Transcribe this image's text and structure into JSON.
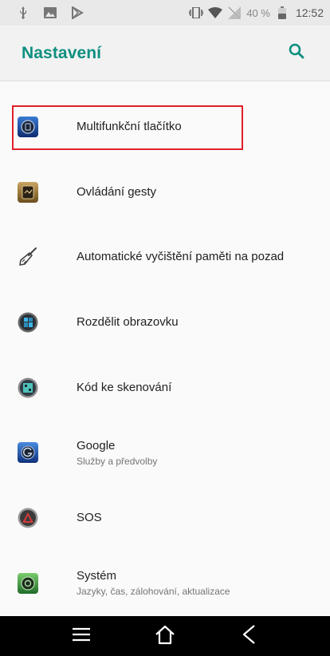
{
  "status_bar": {
    "battery_percent_text": "40 %",
    "time": "12:52",
    "icons_left": [
      "usb-icon",
      "image-icon",
      "play-store-icon"
    ],
    "icons_right": [
      "vibrate-icon",
      "wifi-icon",
      "no-signal-icon",
      "battery-icon"
    ]
  },
  "header": {
    "title": "Nastavení",
    "search_icon": "search-icon",
    "accent_color": "#0e8f80"
  },
  "settings": {
    "items": [
      {
        "title": "Multifunkční tlačítko",
        "subtitle": "",
        "icon": "multifunction-button-icon",
        "highlighted": true
      },
      {
        "title": "Ovládání gesty",
        "subtitle": "",
        "icon": "gesture-control-icon",
        "highlighted": false
      },
      {
        "title": "Automatické vyčištění paměti na pozad",
        "subtitle": "",
        "icon": "broom-cleanup-icon",
        "highlighted": false
      },
      {
        "title": "Rozdělit obrazovku",
        "subtitle": "",
        "icon": "split-screen-icon",
        "highlighted": false
      },
      {
        "title": "Kód ke skenování",
        "subtitle": "",
        "icon": "scan-code-icon",
        "highlighted": false
      },
      {
        "title": "Google",
        "subtitle": "Služby a předvolby",
        "icon": "google-icon",
        "highlighted": false
      },
      {
        "title": "SOS",
        "subtitle": "",
        "icon": "sos-icon",
        "highlighted": false
      },
      {
        "title": "Systém",
        "subtitle": "Jazyky, čas, zálohování, aktualizace",
        "icon": "system-icon",
        "highlighted": false
      }
    ]
  },
  "nav_bar": {
    "buttons": [
      "menu-icon",
      "home-icon",
      "back-icon"
    ]
  },
  "colors": {
    "highlight_border": "#e0202a",
    "background": "#fafafa"
  }
}
